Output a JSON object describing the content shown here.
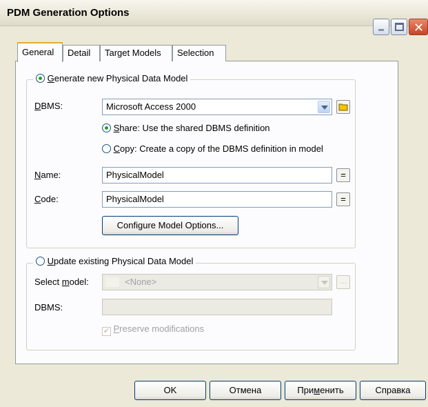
{
  "window": {
    "title": "PDM Generation Options"
  },
  "tabs": [
    {
      "label": "General"
    },
    {
      "label": "Detail"
    },
    {
      "label": "Target Models"
    },
    {
      "label": "Selection"
    }
  ],
  "generate": {
    "legend_accel": "G",
    "legend_rest": "enerate new Physical Data Model",
    "selected": true,
    "dbms_label_accel": "D",
    "dbms_label_rest": "BMS:",
    "dbms_value": "Microsoft Access 2000",
    "share_accel": "S",
    "share_rest": "hare: Use the shared DBMS definition",
    "share_selected": true,
    "copy_accel": "C",
    "copy_rest": "opy: Create a copy of the DBMS definition in model",
    "name_label_accel": "N",
    "name_label_rest": "ame:",
    "name_value": "PhysicalModel",
    "code_label_accel": "C",
    "code_label_rest": "ode:",
    "code_value": "PhysicalModel",
    "equals_glyph": "=",
    "configure_button": "Configure Model Options..."
  },
  "update": {
    "legend_accel": "U",
    "legend_rest": "pdate existing Physical Data Model",
    "selected": false,
    "select_label_pre": "Select ",
    "select_label_accel": "m",
    "select_label_rest": "odel:",
    "select_value": "<None>",
    "browse_glyph": "...",
    "dbms_label": "DBMS:",
    "dbms_value": "",
    "preserve_accel": "P",
    "preserve_rest": "reserve modifications",
    "preserve_checked": true
  },
  "buttons": {
    "ok": "OK",
    "cancel": "Отмена",
    "apply_pre": "При",
    "apply_accel": "м",
    "apply_rest": "енить",
    "help": "Справка"
  },
  "colors": {
    "dialog_bg": "#ece9d8",
    "panel_bg": "#fcfcfe",
    "active_tab_accent": "#e6a92e",
    "folder_icon": "#f5c400"
  }
}
